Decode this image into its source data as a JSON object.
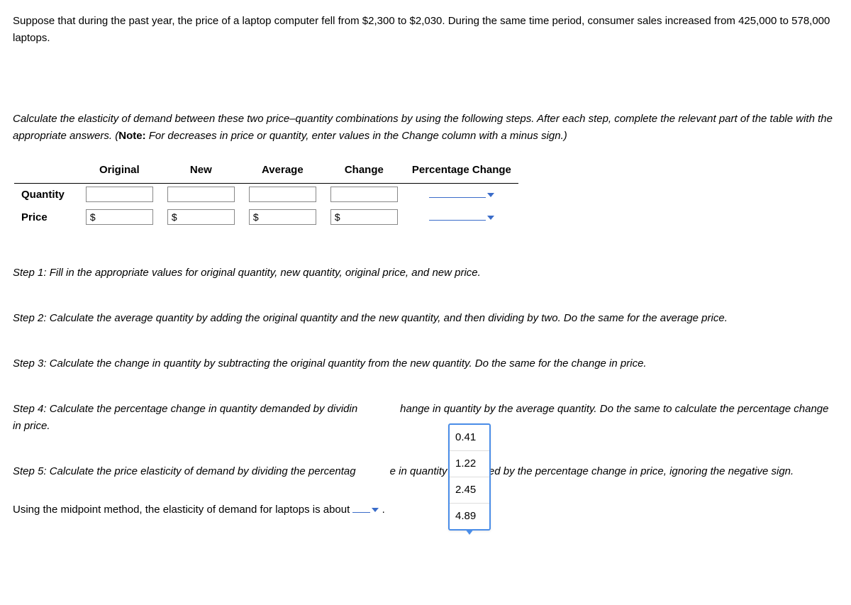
{
  "intro": "Suppose that during the past year, the price of a laptop computer fell from $2,300 to $2,030. During the same time period, consumer sales increased from 425,000 to 578,000 laptops.",
  "instruction_part1": "Calculate the elasticity of demand between these two price–quantity combinations by using the following steps. After each step, complete the relevant part of the table with the appropriate answers. (",
  "instruction_note_label": "Note:",
  "instruction_part2": " For decreases in price or quantity, enter values in the Change column with a minus sign.)",
  "table": {
    "headers": [
      "",
      "Original",
      "New",
      "Average",
      "Change",
      "Percentage Change"
    ],
    "rows": [
      {
        "label": "Quantity",
        "prefix": ""
      },
      {
        "label": "Price",
        "prefix": "$"
      }
    ]
  },
  "steps": {
    "s1": "Step 1: Fill in the appropriate values for original quantity, new quantity, original price, and new price.",
    "s2": "Step 2: Calculate the average quantity by adding the original quantity and the new quantity, and then dividing by two. Do the same for the average price.",
    "s3": "Step 3: Calculate the change in quantity by subtracting the original quantity from the new quantity. Do the same for the change in price.",
    "s4a": "Step 4: Calculate the percentage change in quantity demanded by dividin",
    "s4b": "hange in quantity by the average quantity. Do the same to calculate the percentage change in price.",
    "s5a": "Step 5: Calculate the price elasticity of demand by dividing the percentag",
    "s5b": "e in quantity demanded by the percentage change in price, ignoring the negative sign."
  },
  "dropdown_options": [
    "0.41",
    "1.22",
    "2.45",
    "4.89"
  ],
  "final": "Using the midpoint method, the elasticity of demand for laptops is about",
  "final_period": "."
}
